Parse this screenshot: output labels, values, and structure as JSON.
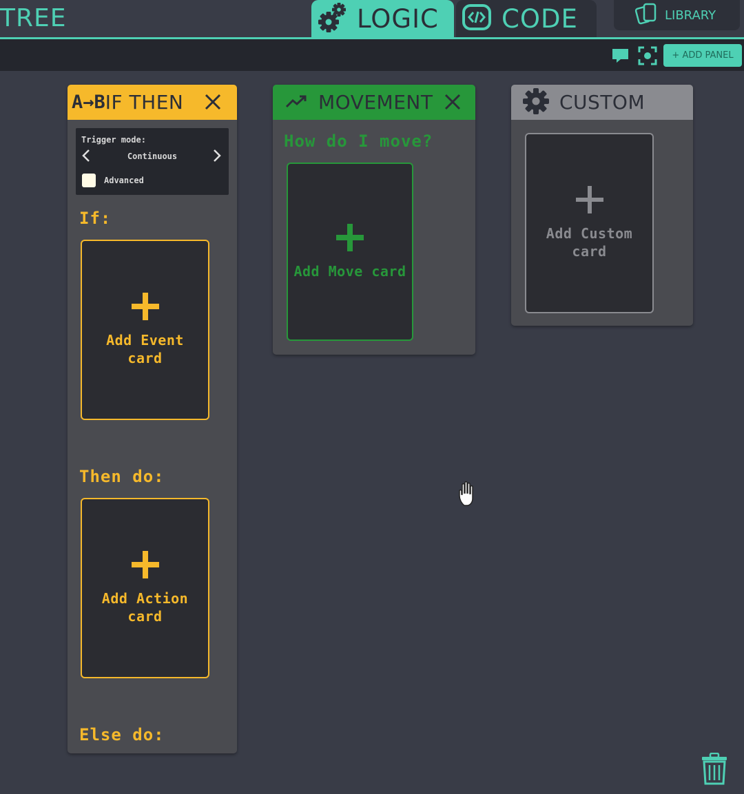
{
  "app": {
    "title": "TREE"
  },
  "tabs": [
    {
      "label": "LOGIC",
      "icon": "gears-icon",
      "active": true
    },
    {
      "label": "CODE",
      "icon": "code-icon",
      "active": false
    }
  ],
  "library": {
    "label": "LIBRARY",
    "icon": "cards-icon"
  },
  "toolbar": {
    "add_panel_label": "+ ADD PANEL",
    "chat_icon": "chat-bubble-icon",
    "focus_icon": "focus-target-icon"
  },
  "panels": {
    "ifthen": {
      "title": "IF THEN",
      "icon_text": "A→B",
      "trigger": {
        "label": "Trigger mode:",
        "value": "Continuous",
        "advanced_label": "Advanced"
      },
      "if_label": "If:",
      "event_card": {
        "line1": "Add Event",
        "line2": "card"
      },
      "then_label": "Then do:",
      "action_card": {
        "line1": "Add Action",
        "line2": "card"
      },
      "else_label": "Else do:"
    },
    "movement": {
      "title": "MOVEMENT",
      "question": "How do I move?",
      "card": {
        "text": "Add Move card"
      }
    },
    "custom": {
      "title": "CUSTOM",
      "card": {
        "line1": "Add Custom",
        "line2": "card"
      }
    }
  },
  "colors": {
    "accent": "#4ed0b4",
    "ifthen": "#f6b92b",
    "movement": "#27973a",
    "custom": "#8a8b90",
    "background": "#393c47"
  }
}
